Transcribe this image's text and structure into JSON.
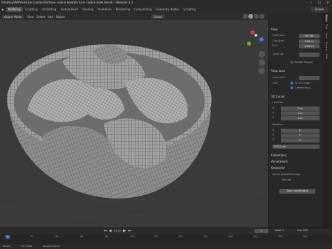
{
  "window": {
    "title": "Desktop\\WIP\\Fortune Cookies\\fortune cookie bowl\\fortune cookie bowl.blend] - Blender 4.1"
  },
  "menubar": {
    "workspaces": [
      "Modeling",
      "Sculpting",
      "UV Editing",
      "Texture Paint",
      "Shading",
      "Animation",
      "Rendering",
      "Compositing",
      "Geometry Nodes",
      "Scripting"
    ],
    "active_workspace": "Modeling",
    "scene": "Scene"
  },
  "header": {
    "mode": "Object Mode",
    "pivot": "Global",
    "view": "View",
    "select": "Select",
    "add": "Add",
    "object": "Object"
  },
  "n_panel": {
    "tabs": [
      "Item",
      "Tool",
      "View",
      "Create",
      "Edit"
    ],
    "view_section": "View",
    "focal_length_label": "Focal Len...",
    "focal_length_value": "50 mm",
    "clip_start_label": "Clip Start",
    "clip_start_value": "0.01 m",
    "clip_end_label": "End",
    "clip_end_value": "1000 m",
    "local_camera_label": "Local Ca...",
    "render_region_label": "Render Region",
    "view_lock_section": "View Lock",
    "lock_to_object_label": "Lock to O...",
    "lock_label": "Lock",
    "to_3d_cursor": "To 3D Cursor",
    "camera_to_view": "Camera to V...",
    "cursor_section": "3D Cursor",
    "location_label": "Location",
    "location": [
      {
        "axis": "X",
        "value": "0 m"
      },
      {
        "axis": "Y",
        "value": "0 m"
      },
      {
        "axis": "Z",
        "value": "0 m"
      }
    ],
    "rotation_label": "Rotation",
    "rotation": [
      {
        "axis": "X",
        "value": "0°"
      },
      {
        "axis": "Y",
        "value": "0°"
      },
      {
        "axis": "Z",
        "value": "0°"
      }
    ],
    "rotation_mode": "XYZ Euler",
    "collections_section": "Collections",
    "annotations_section": "Annotations",
    "geoscene_section": "Geoscene",
    "geoscene_label": "Scene georeferencing :",
    "not_set": "Not set",
    "sync_button": "Sync coordinates"
  },
  "timeline": {
    "current_frame": "1",
    "start_label": "Start",
    "start_value": "1",
    "end_label": "End",
    "end_value": "250",
    "ruler": [
      "1",
      "20",
      "40",
      "60",
      "80",
      "100",
      "120",
      "140",
      "160",
      "180",
      "200",
      "220",
      "240"
    ]
  },
  "statusbar": {
    "select": "Select",
    "pan_view": "Pan View",
    "context_menu": "Context Menu"
  },
  "colors": {
    "accent": "#4772b3",
    "viewport_bg": "#3a3a3a",
    "mesh": "#9c9c9c",
    "wire": "#4e4e4e"
  }
}
